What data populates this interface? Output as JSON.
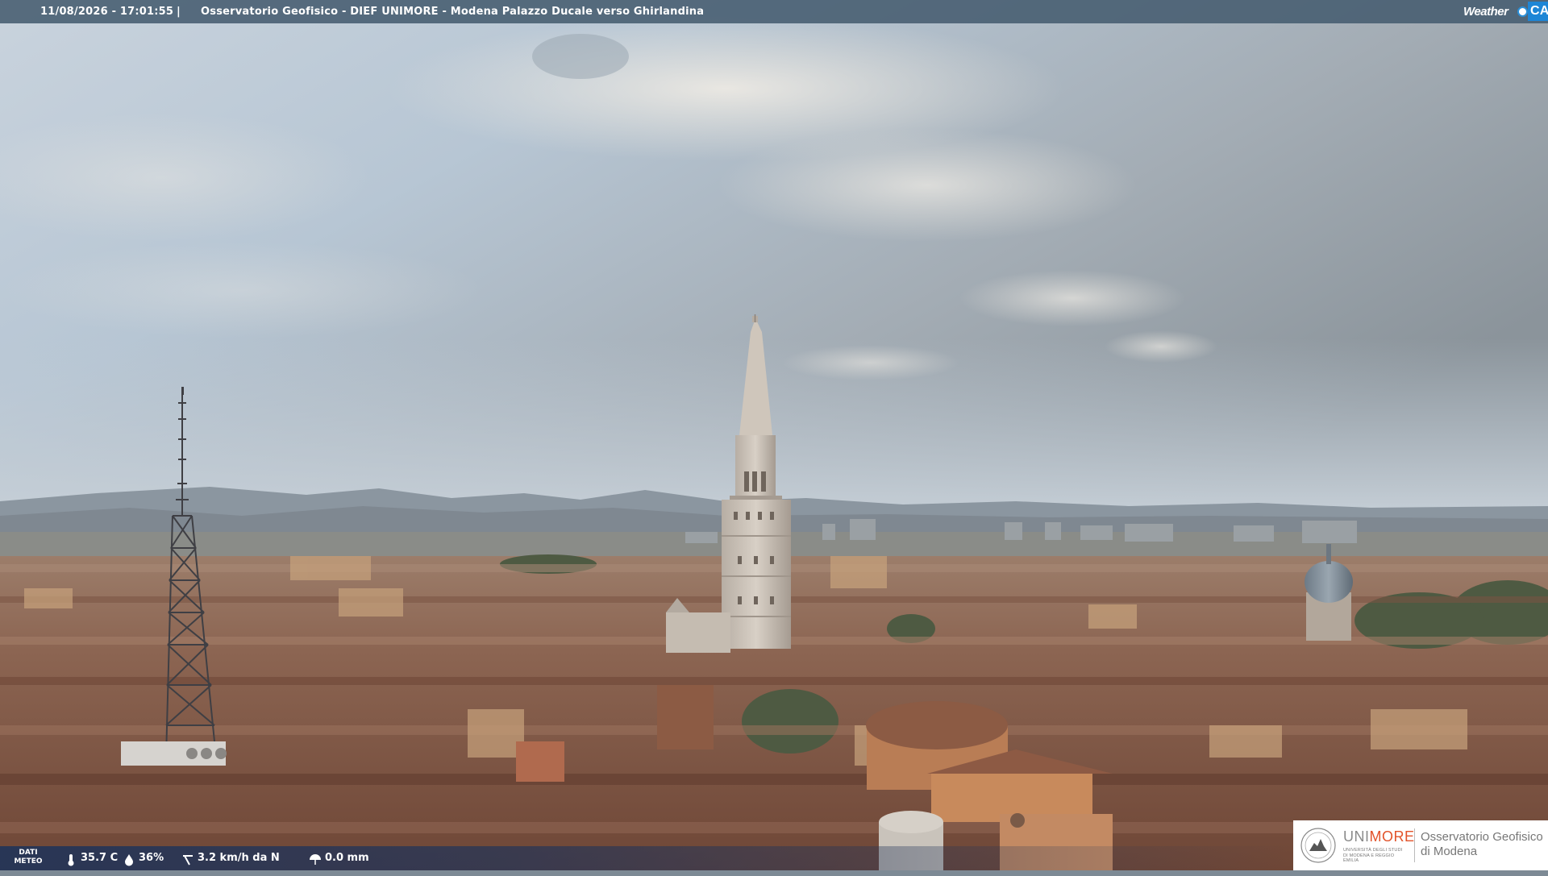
{
  "header": {
    "timestamp": "11/08/2026 - 17:01:55",
    "separator": "|",
    "title": "Osservatorio Geofisico - DIEF UNIMORE - Modena Palazzo Ducale verso Ghirlandina"
  },
  "brand_logo": {
    "weather": "Weather",
    "cam": "CAM",
    "icon": "camera-dot-icon",
    "accent_color": "#1e86d6"
  },
  "weather_bar": {
    "label": "DATI METEO",
    "temperature": {
      "icon": "thermometer-icon",
      "value": "35.7 C"
    },
    "humidity": {
      "icon": "water-drop-icon",
      "value": "36%"
    },
    "wind": {
      "icon": "wind-icon",
      "value": "3.2 km/h da N"
    },
    "rain": {
      "icon": "umbrella-icon",
      "value": "0.0 mm"
    }
  },
  "institution_logo": {
    "uni": "UNI",
    "more": "MORE",
    "subtitle": "UNIVERSITÀ DEGLI STUDI DI MODENA E REGGIO EMILIA",
    "observatory": "Osservatorio Geofisico di Modena",
    "accent_color": "#e2532a"
  },
  "scene": {
    "description_icon": "webcam-cityscape-image"
  }
}
